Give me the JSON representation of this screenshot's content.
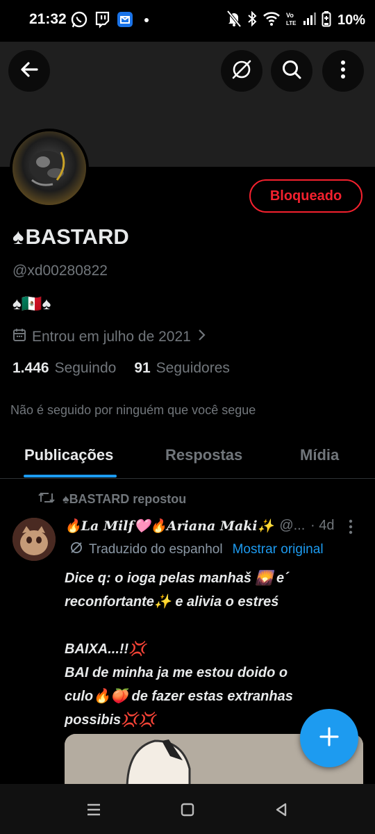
{
  "status_bar": {
    "time": "21:32",
    "battery": "10%",
    "icons": [
      "whatsapp-icon",
      "twitch-icon",
      "app-icon",
      "dot-icon",
      "mute-icon",
      "bluetooth-icon",
      "wifi-icon",
      "volte-icon",
      "signal-icon",
      "battery-icon"
    ]
  },
  "header": {
    "back_icon": "arrow-left-icon",
    "grok_icon": "slash-circle-icon",
    "search_icon": "search-icon",
    "more_icon": "more-vertical-icon"
  },
  "profile": {
    "block_button": "Bloqueado",
    "name_prefix": "♠",
    "name": "BASTARD",
    "handle": "@xd00280822",
    "bio": "♠🇲🇽♠",
    "joined": "Entrou em julho de 2021",
    "following_count": "1.446",
    "following_label": "Seguindo",
    "followers_count": "91",
    "followers_label": "Seguidores",
    "not_followed": "Não é seguido por ninguém que você segue"
  },
  "tabs": [
    {
      "label": "Publicações",
      "active": true
    },
    {
      "label": "Respostas",
      "active": false
    },
    {
      "label": "Mídia",
      "active": false
    }
  ],
  "post": {
    "repost_by": "♠BASTARD repostou",
    "author": "🔥𝑳𝒂 𝑴𝒊𝒍𝒇🩷🔥𝑨𝒓𝒊𝒂𝒏𝒂 𝑴𝒂𝒌𝒊✨",
    "handle": "@...",
    "time": "· 4d",
    "translated": "Traduzido do espanhol",
    "show_original": "Mostrar original",
    "lines": [
      "Dice q: o ioga pelas manhaš 🌄 e´",
      "reconfortante✨ e alivia o estreś",
      "BAIXA...!!💢",
      "BAI de minha ja me estou doido o",
      "culo🔥🍑 de fazer estas extranhas",
      "possibis💢💢"
    ]
  },
  "colors": {
    "accent": "#1d9bf0",
    "blocked": "#f4212e",
    "muted": "#71767b",
    "text": "#e7e9ea"
  }
}
